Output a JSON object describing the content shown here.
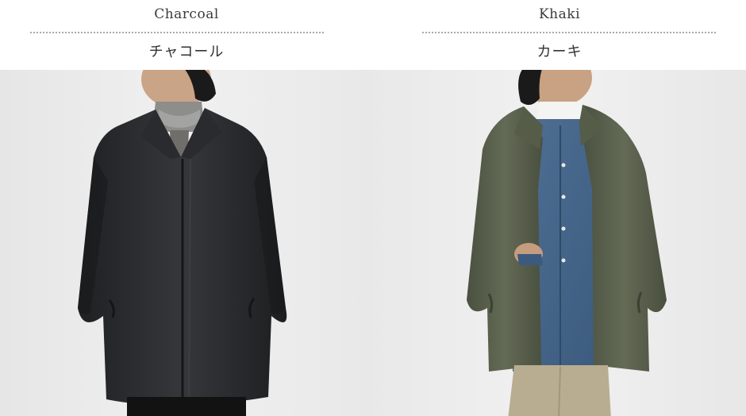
{
  "colors": [
    {
      "name_en": "Charcoal",
      "name_jp": "チャコール",
      "swatch": "#2b2c2e",
      "photo_alt": "Man wearing charcoal coat over gray turtleneck"
    },
    {
      "name_en": "Khaki",
      "name_jp": "カーキ",
      "swatch": "#59604a",
      "photo_alt": "Man wearing khaki coat over denim shirt and white turtleneck"
    }
  ]
}
